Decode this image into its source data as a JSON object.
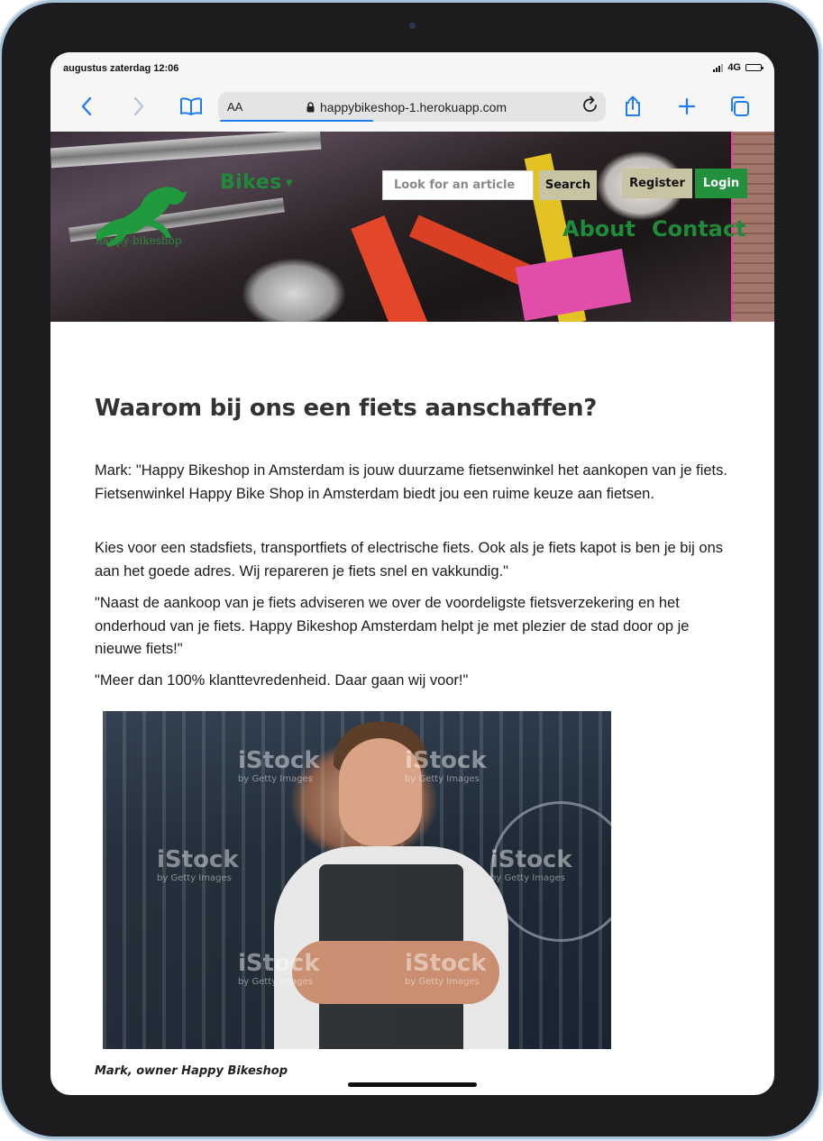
{
  "status": {
    "time": "augustus zaterdag 12:06",
    "network": "4G"
  },
  "browser": {
    "text_size_label": "AA",
    "url": "happybikeshop-1.herokuapp.com",
    "icons": [
      "chevron-left-icon",
      "chevron-right-icon",
      "bookmarks-icon",
      "lock-icon",
      "reload-icon",
      "share-icon",
      "new-tab-icon",
      "tabs-icon"
    ]
  },
  "header": {
    "logo_text": "happy bikeshop",
    "nav_bikes": "Bikes",
    "search_placeholder": "Look for an article",
    "search_button": "Search",
    "register_button": "Register",
    "login_button": "Login",
    "nav_about": "About",
    "nav_contact": "Contact",
    "colors": {
      "green": "#23903e",
      "beige": "#c8c3a2"
    }
  },
  "main": {
    "title": "Waarom bij ons een fiets aanschaffen?",
    "paragraphs": [
      "Mark: \"Happy Bikeshop in Amsterdam is jouw duurzame fietsenwinkel het aankopen van je fiets. Fietsenwinkel Happy Bike Shop in Amsterdam biedt jou een ruime keuze aan fietsen.",
      "Kies voor een stadsfiets, transportfiets of electrische fiets. Ook als je fiets kapot is ben je bij ons aan het goede adres. Wij repareren je fiets snel en vakkundig.\"",
      "\"Naast de aankoop van je fiets adviseren we over de voordeligste fietsverzekering en het onderhoud van je fiets. Happy Bikeshop Amsterdam helpt je met plezier de stad door op je nieuwe fiets!\"",
      "\"Meer dan 100% klanttevredenheid. Daar gaan wij voor!\""
    ],
    "photo_watermark": "iStock",
    "photo_watermark_sub": "by Getty Images",
    "caption": "Mark, owner Happy Bikeshop"
  }
}
